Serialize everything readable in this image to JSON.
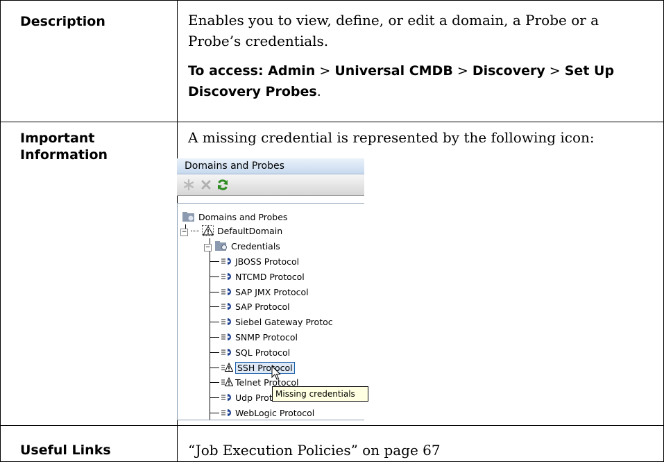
{
  "rows": [
    {
      "header": "Description"
    },
    {
      "header": "Important Information"
    },
    {
      "header": "Useful Links"
    }
  ],
  "description": {
    "text": "Enables you to view, define, or edit a domain, a Probe or a Probe’s credentials.",
    "access_intro": "To access: ",
    "path": [
      "Admin",
      "Universal CMDB",
      "Discovery",
      "Set Up Discovery Probes"
    ],
    "separator": " > "
  },
  "important": {
    "text": "A missing credential is represented by the following icon:"
  },
  "screenshot": {
    "panel_title": "Domains and Probes",
    "toolbar_icons": [
      "new-icon",
      "delete-icon",
      "refresh-icon"
    ],
    "tree": {
      "root": "Domains and Probes",
      "domain": "DefaultDomain",
      "folder": "Credentials",
      "items": [
        {
          "label": "JBOSS Protocol",
          "warning": false
        },
        {
          "label": "NTCMD Protocol",
          "warning": false
        },
        {
          "label": "SAP JMX Protocol",
          "warning": false
        },
        {
          "label": "SAP Protocol",
          "warning": false
        },
        {
          "label": "Siebel Gateway Protoc",
          "warning": false
        },
        {
          "label": "SNMP Protocol",
          "warning": false
        },
        {
          "label": "SQL Protocol",
          "warning": false
        },
        {
          "label": "SSH Protocol",
          "warning": true,
          "selected": true
        },
        {
          "label": "Telnet Protocol",
          "warning": true
        },
        {
          "label": "Udp Protocol",
          "warning": false
        },
        {
          "label": "WebLogic Protocol",
          "warning": false
        }
      ]
    },
    "tooltip": "Missing credentials"
  },
  "useful_links": {
    "link_text": "“Job Execution Policies” on page 67"
  }
}
